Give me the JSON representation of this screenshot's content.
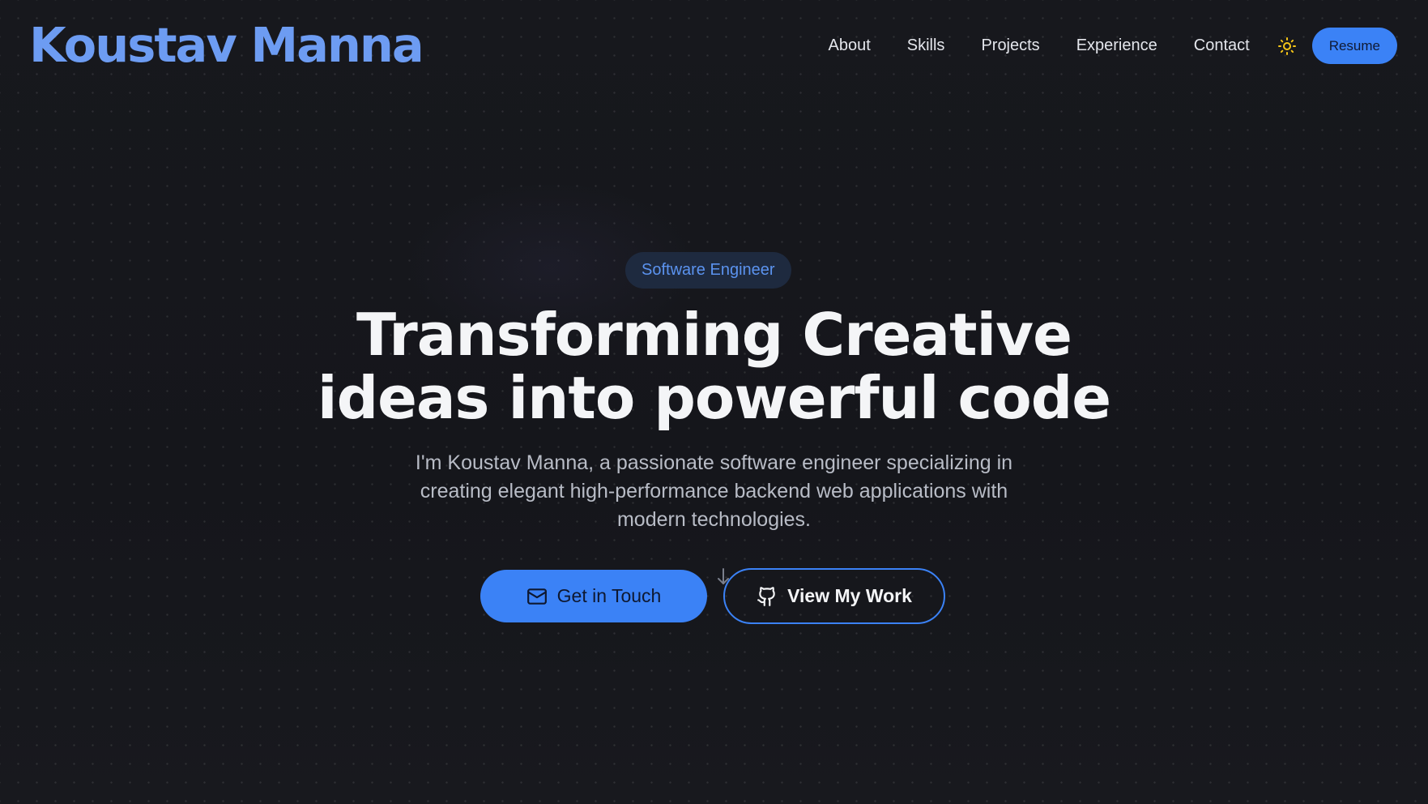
{
  "header": {
    "logo": "Koustav Manna",
    "nav": [
      "About",
      "Skills",
      "Projects",
      "Experience",
      "Contact"
    ],
    "theme_icon": "sun-icon",
    "resume_label": "Resume"
  },
  "hero": {
    "badge": "Software Engineer",
    "headline_line1": "Transforming Creative",
    "headline_line2": "ideas into powerful code",
    "subtitle": "I'm Koustav Manna, a passionate software engineer specializing in creating elegant high-performance backend web applications with modern technologies.",
    "primary_button": {
      "label": "Get in Touch",
      "icon": "mail-icon"
    },
    "secondary_button": {
      "label": "View My Work",
      "icon": "github-icon"
    },
    "scroll_icon": "arrow-down-icon"
  },
  "colors": {
    "background": "#15161b",
    "accent": "#3b82f6",
    "logo": "#6d9cf2",
    "badge_text": "#5b93ef",
    "sun": "#f5c518"
  }
}
